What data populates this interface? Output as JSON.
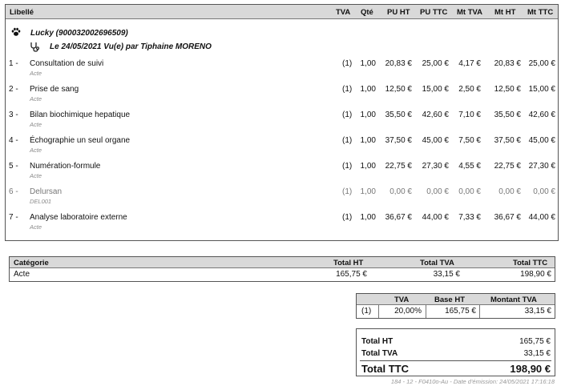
{
  "header": {
    "libelle": "Libellé",
    "tva": "TVA",
    "qte": "Qté",
    "pu_ht": "PU HT",
    "pu_ttc": "PU TTC",
    "mt_tva": "Mt TVA",
    "mt_ht": "Mt HT",
    "mt_ttc": "Mt TTC"
  },
  "patient": {
    "name": "Lucky (900032002696509)",
    "visit": "Le 24/05/2021 Vu(e) par Tiphaine MORENO",
    "animal_icon": "paw-icon",
    "visit_icon": "stethoscope-icon"
  },
  "lines": [
    {
      "idx": "1 -",
      "label": "Consultation de suivi",
      "sub": "Acte",
      "tva": "(1)",
      "qte": "1,00",
      "pu_ht": "20,83 €",
      "pu_ttc": "25,00 €",
      "mt_tva": "4,17 €",
      "mt_ht": "20,83 €",
      "mt_ttc": "25,00 €"
    },
    {
      "idx": "2 -",
      "label": "Prise de sang",
      "sub": "Acte",
      "tva": "(1)",
      "qte": "1,00",
      "pu_ht": "12,50 €",
      "pu_ttc": "15,00 €",
      "mt_tva": "2,50 €",
      "mt_ht": "12,50 €",
      "mt_ttc": "15,00 €"
    },
    {
      "idx": "3 -",
      "label": "Bilan biochimique hepatique",
      "sub": "Acte",
      "tva": "(1)",
      "qte": "1,00",
      "pu_ht": "35,50 €",
      "pu_ttc": "42,60 €",
      "mt_tva": "7,10 €",
      "mt_ht": "35,50 €",
      "mt_ttc": "42,60 €"
    },
    {
      "idx": "4 -",
      "label": "Échographie un seul organe",
      "sub": "Acte",
      "tva": "(1)",
      "qte": "1,00",
      "pu_ht": "37,50 €",
      "pu_ttc": "45,00 €",
      "mt_tva": "7,50 €",
      "mt_ht": "37,50 €",
      "mt_ttc": "45,00 €"
    },
    {
      "idx": "5 -",
      "label": "Numération-formule",
      "sub": "Acte",
      "tva": "(1)",
      "qte": "1,00",
      "pu_ht": "22,75 €",
      "pu_ttc": "27,30 €",
      "mt_tva": "4,55 €",
      "mt_ht": "22,75 €",
      "mt_ttc": "27,30 €"
    },
    {
      "idx": "6 -",
      "label": "Delursan",
      "sub": "DEL001",
      "tva": "(1)",
      "qte": "1,00",
      "pu_ht": "0,00 €",
      "pu_ttc": "0,00 €",
      "mt_tva": "0,00 €",
      "mt_ht": "0,00 €",
      "mt_ttc": "0,00 €",
      "muted": true
    },
    {
      "idx": "7 -",
      "label": "Analyse laboratoire externe",
      "sub": "Acte",
      "tva": "(1)",
      "qte": "1,00",
      "pu_ht": "36,67 €",
      "pu_ttc": "44,00 €",
      "mt_tva": "7,33 €",
      "mt_ht": "36,67 €",
      "mt_ttc": "44,00 €"
    }
  ],
  "category_table": {
    "headers": {
      "categorie": "Catégorie",
      "total_ht": "Total HT",
      "total_tva": "Total TVA",
      "total_ttc": "Total TTC"
    },
    "row": {
      "categorie": "Acte",
      "total_ht": "165,75 €",
      "total_tva": "33,15 €",
      "total_ttc": "198,90 €"
    }
  },
  "vat_table": {
    "headers": {
      "tva": "TVA",
      "base_ht": "Base HT",
      "montant_tva": "Montant TVA"
    },
    "row": {
      "code": "(1)",
      "tva": "20,00%",
      "base_ht": "165,75 €",
      "montant_tva": "33,15 €"
    }
  },
  "totals": {
    "total_ht_label": "Total HT",
    "total_ht": "165,75 €",
    "total_tva_label": "Total TVA",
    "total_tva": "33,15 €",
    "total_ttc_label": "Total TTC",
    "total_ttc": "198,90 €"
  },
  "footer": {
    "reference": "184 - 12 - F0410o-Au - Date d'émission: 24/05/2021 17:16:18"
  },
  "colors": {
    "header_bg": "#d9d9d9",
    "muted_text": "#777777"
  }
}
